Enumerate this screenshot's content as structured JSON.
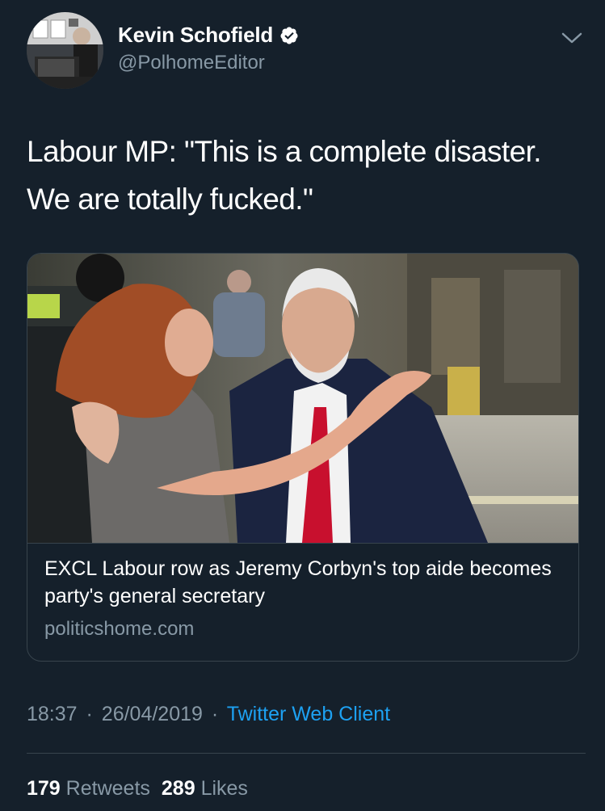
{
  "author": {
    "display_name": "Kevin Schofield",
    "handle": "@PolhomeEditor",
    "verified": true
  },
  "tweet": {
    "text": "Labour MP: \"This is a complete disaster. We are totally fucked.\""
  },
  "card": {
    "title": "EXCL Labour row as Jeremy Corbyn's top aide becomes party's general secretary",
    "domain": "politicshome.com"
  },
  "meta": {
    "time": "18:37",
    "separator": "·",
    "date": "26/04/2019",
    "client": "Twitter Web Client"
  },
  "stats": {
    "retweets_count": "179",
    "retweets_label": "Retweets",
    "likes_count": "289",
    "likes_label": "Likes"
  },
  "colors": {
    "background": "#15202b",
    "secondary_text": "#8899a6",
    "accent": "#1da1f2",
    "border": "#38444d"
  },
  "icons": {
    "verified": "verified-badge-icon",
    "menu": "chevron-down-icon"
  }
}
